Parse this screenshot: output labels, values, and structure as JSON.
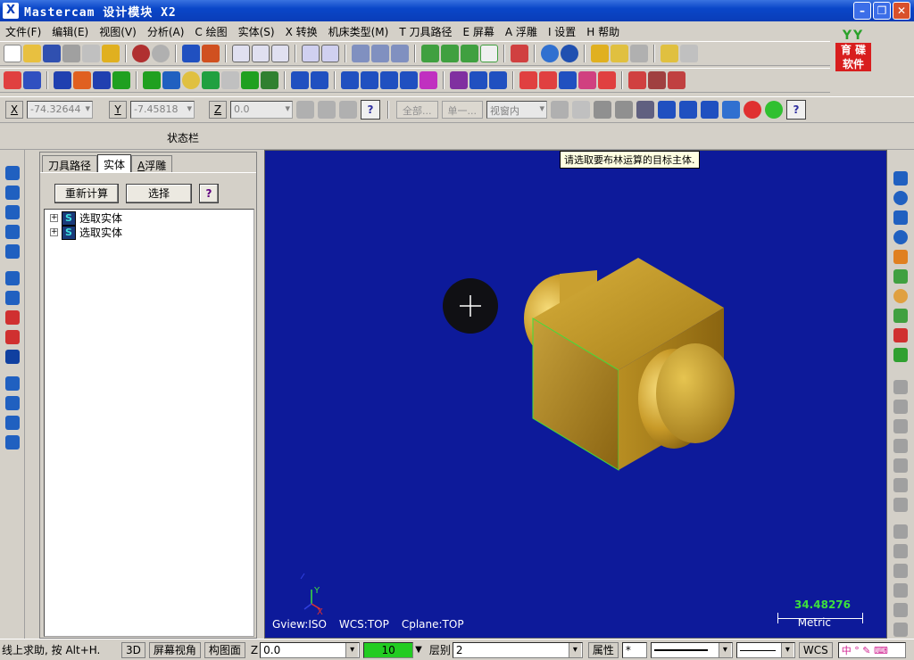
{
  "window": {
    "title": "Mastercam 设计模块  X2",
    "icon": "mastercam-x-icon"
  },
  "menu": [
    {
      "label": "文件(F)"
    },
    {
      "label": "编辑(E)"
    },
    {
      "label": "视图(V)"
    },
    {
      "label": "分析(A)"
    },
    {
      "label": "C 绘图"
    },
    {
      "label": "实体(S)"
    },
    {
      "label": "X 转换"
    },
    {
      "label": "机床类型(M)"
    },
    {
      "label": "T 刀具路径"
    },
    {
      "label": "E 屏幕"
    },
    {
      "label": "A 浮雕"
    },
    {
      "label": "I 设置"
    },
    {
      "label": "H 帮助"
    }
  ],
  "logo": {
    "line1": "育 碟",
    "line2": "软件",
    "top": "YY"
  },
  "coords": {
    "x_label": "X",
    "x_value": "-74.32644",
    "y_label": "Y",
    "y_value": "-7.45818",
    "z_label": "Z",
    "z_value": "0.0",
    "all_button": "全部...",
    "single_button": "单一...",
    "view_mode": "视窗内"
  },
  "status_bar_label": "状态栏",
  "manager": {
    "tabs": [
      {
        "label": "刀具路径",
        "active": false
      },
      {
        "label": "实体",
        "active": true
      },
      {
        "label": "浮雕",
        "prefix": "A",
        "active": false
      }
    ],
    "regen_button": "重新计算",
    "select_button": "选择",
    "help_button": "?",
    "tree": [
      {
        "label": "选取实体",
        "icon": "S"
      },
      {
        "label": "选取实体",
        "icon": "S"
      }
    ]
  },
  "viewport": {
    "prompt": "请选取要布林运算的目标主体.",
    "gview": "Gview:ISO",
    "wcs": "WCS:TOP",
    "cplane": "Cplane:TOP",
    "scale_value": "34.48276",
    "scale_unit": "Metric",
    "axis_y": "Y",
    "axis_x": "X"
  },
  "bottombar": {
    "hint": "线上求助, 按 Alt+H.",
    "btn_3d": "3D",
    "btn_gview": "屏幕视角",
    "btn_cplane": "构图面",
    "z_label": "Z",
    "z_value": "0.0",
    "color_value": "10",
    "level_label": "层别",
    "level_value": "2",
    "attr_button": "属性",
    "point_style": "*",
    "wcs_button": "WCS"
  },
  "colors": {
    "viewport_bg": "#0d1a9a",
    "solid_gold": "#c8a02a",
    "edge_green": "#3de03d",
    "color_swatch": "#22cc22"
  }
}
